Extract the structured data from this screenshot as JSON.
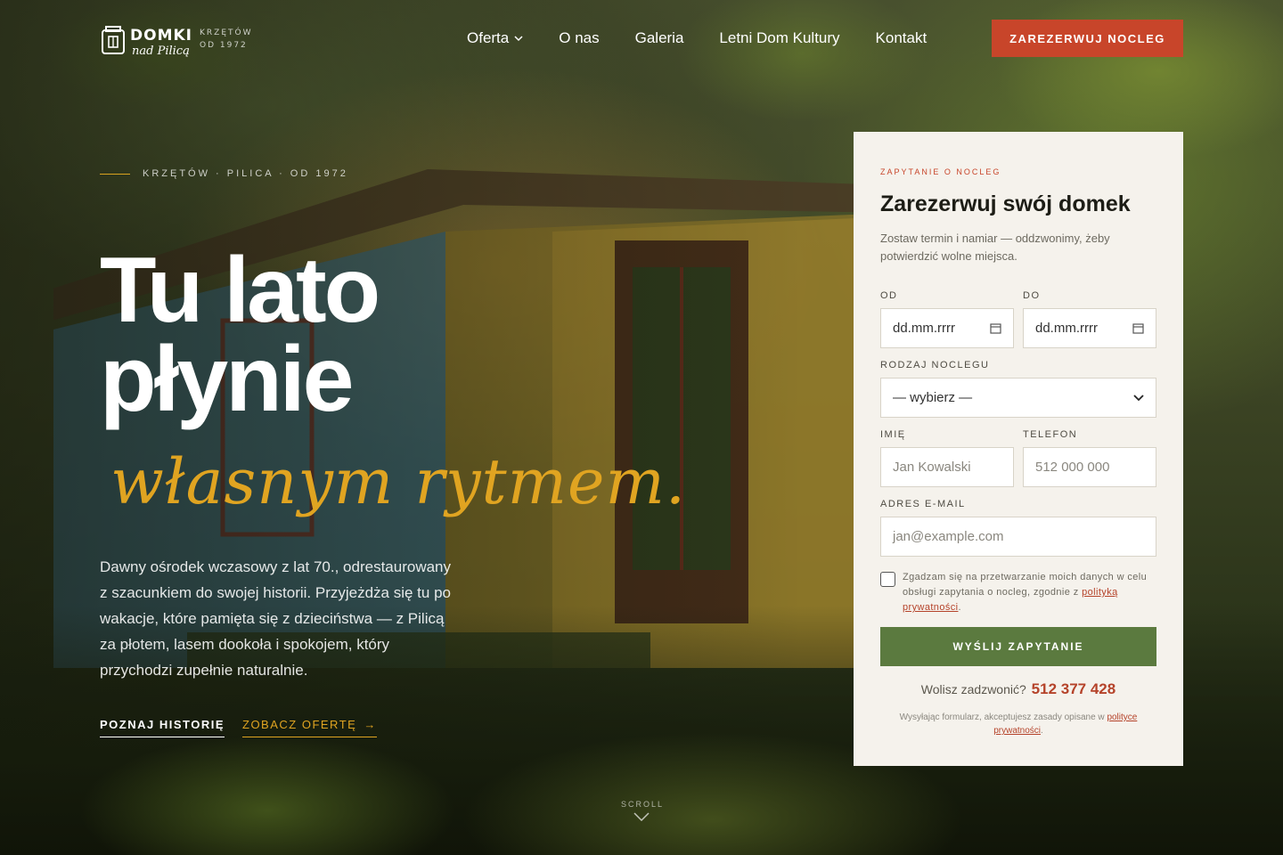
{
  "logo": {
    "main": "DOMKI",
    "script": "nad Pilicą",
    "tagline_1": "KRZĘTÓW",
    "tagline_2": "OD 1972"
  },
  "nav": {
    "items": [
      {
        "label": "Oferta",
        "has_dropdown": true
      },
      {
        "label": "O nas"
      },
      {
        "label": "Galeria"
      },
      {
        "label": "Letni Dom Kultury"
      },
      {
        "label": "Kontakt"
      }
    ],
    "cta": "ZAREZERWUJ NOCLEG"
  },
  "hero": {
    "eyebrow": "KRZĘTÓW · PILICA · OD 1972",
    "title_line_1": "Tu lato",
    "title_line_2": "płynie",
    "script": "własnym rytmem.",
    "lead": "Dawny ośrodek wczasowy z lat 70., odrestaurowany z szacunkiem do swojej historii. Przyjeżdża się tu po wakacje, które pamięta się z dzieciństwa — z Pilicą za płotem, lasem dookoła i spokojem, który przychodzi zupełnie naturalnie.",
    "link_primary": "POZNAJ HISTORIĘ",
    "link_secondary": "ZOBACZ OFERTĘ",
    "link_secondary_arrow": "→",
    "scroll_label": "SCROLL"
  },
  "booking": {
    "eyebrow": "ZAPYTANIE O NOCLEG",
    "title": "Zarezerwuj swój domek",
    "description": "Zostaw termin i namiar — oddzwonimy, żeby potwierdzić wolne miejsca.",
    "from_label": "OD",
    "from_value": "dd.mm.rrrr",
    "to_label": "DO",
    "to_value": "dd.mm.rrrr",
    "type_label": "RODZAJ NOCLEGU",
    "type_selected": "— wybierz —",
    "name_label": "IMIĘ",
    "name_placeholder": "Jan Kowalski",
    "phone_label": "TELEFON",
    "phone_placeholder": "512 000 000",
    "email_label": "ADRES E-MAIL",
    "email_placeholder": "jan@example.com",
    "consent_text": "Zgadzam się na przetwarzanie moich danych w celu obsługi zapytania o nocleg, zgodnie z",
    "consent_link": "polityką prywatności",
    "consent_end": ".",
    "submit": "WYŚLIJ ZAPYTANIE",
    "call_text": "Wolisz zadzwonić?",
    "call_phone": "512 377 428",
    "fine_text": "Wysyłając formularz, akceptujesz zasady opisane w",
    "fine_link": "polityce prywatności",
    "fine_end": "."
  },
  "colors": {
    "accent_red": "#c8452a",
    "accent_gold": "#e0a421",
    "accent_green": "#5b7a3f",
    "card_bg": "#f5f2ec"
  },
  "icons": [
    "logo-jar-icon",
    "chevron-down-icon",
    "calendar-icon",
    "select-chevron-icon",
    "arrow-right-icon",
    "scroll-chevron-icon"
  ]
}
